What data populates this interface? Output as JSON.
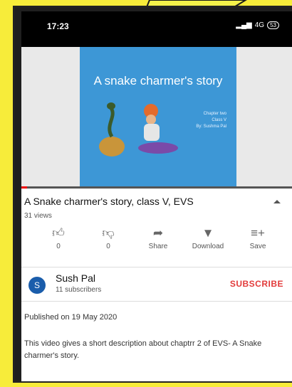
{
  "status_bar": {
    "time": "17:23",
    "network": "4G",
    "battery": "53"
  },
  "video": {
    "slide_title": "A snake charmer's story",
    "slide_meta": [
      "Chapter two",
      "Class V",
      "By: Sushma Pal"
    ],
    "progress_percent": 2
  },
  "details": {
    "title": "A Snake charmer's story, class V, EVS",
    "views": "31 views",
    "actions": [
      {
        "icon": "thumb-up-icon",
        "label": "0"
      },
      {
        "icon": "thumb-down-icon",
        "label": "0"
      },
      {
        "icon": "share-icon",
        "label": "Share"
      },
      {
        "icon": "download-icon",
        "label": "Download"
      },
      {
        "icon": "save-playlist-icon",
        "label": "Save"
      }
    ]
  },
  "channel": {
    "avatar_letter": "S",
    "name": "Sush Pal",
    "subscribers": "11 subscribers",
    "subscribe_label": "SUBSCRIBE"
  },
  "published": "Published on 19 May 2020",
  "description": "This video gives a short description about chaptrr 2 of EVS- A Snake charmer's story.",
  "colors": {
    "background": "#f7ec3a",
    "accent": "#e23b3b",
    "avatar": "#1a5dab",
    "slide": "#3d97d6"
  }
}
